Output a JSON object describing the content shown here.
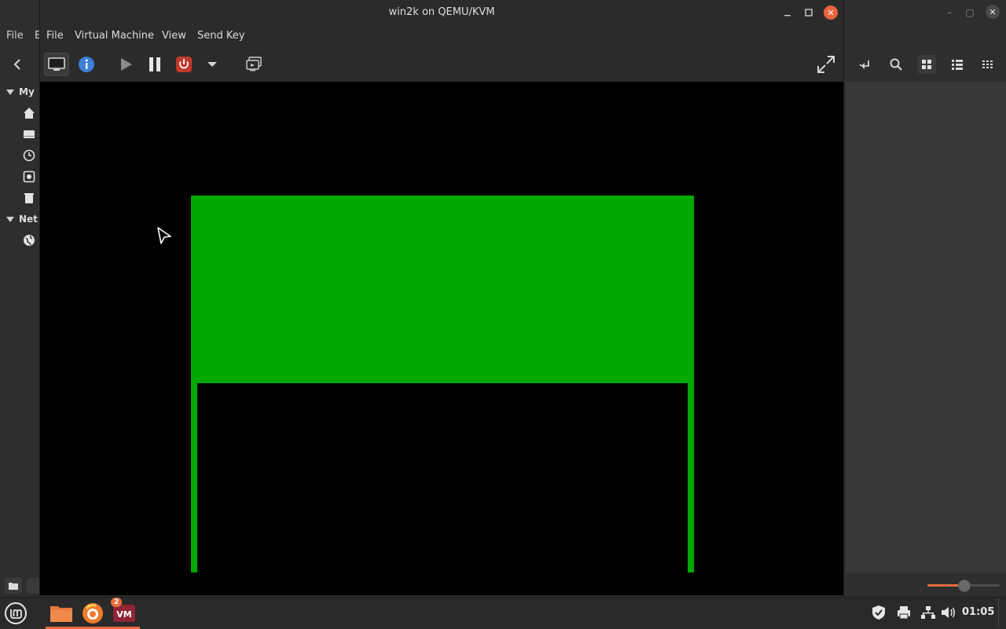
{
  "file_manager": {
    "menu": {
      "file": "File",
      "edit_partial": "E"
    },
    "sidebar": {
      "section_my": "My",
      "section_network": "Net"
    },
    "zoom_level_fraction": 0.5
  },
  "vm_window": {
    "title": "win2k on QEMU/KVM",
    "menu": {
      "file": "File",
      "virtual_machine": "Virtual Machine",
      "view": "View",
      "send_key": "Send Key"
    },
    "toolbar": {
      "console": "monitor-icon",
      "details": "info-icon",
      "run": "play-icon",
      "pause": "pause-icon",
      "shutdown": "power-icon",
      "shutdown_menu": "chevron-down-icon",
      "snapshots": "snapshot-icon",
      "fullscreen": "fullscreen-icon"
    },
    "display": {
      "guest_color": "#00a800"
    }
  },
  "taskbar": {
    "vm_badge": "2",
    "clock": "01:05"
  },
  "colors": {
    "accent": "#e86b3a",
    "close": "#e8643c",
    "power_red": "#c0392b",
    "info_blue": "#3d7fd9"
  }
}
